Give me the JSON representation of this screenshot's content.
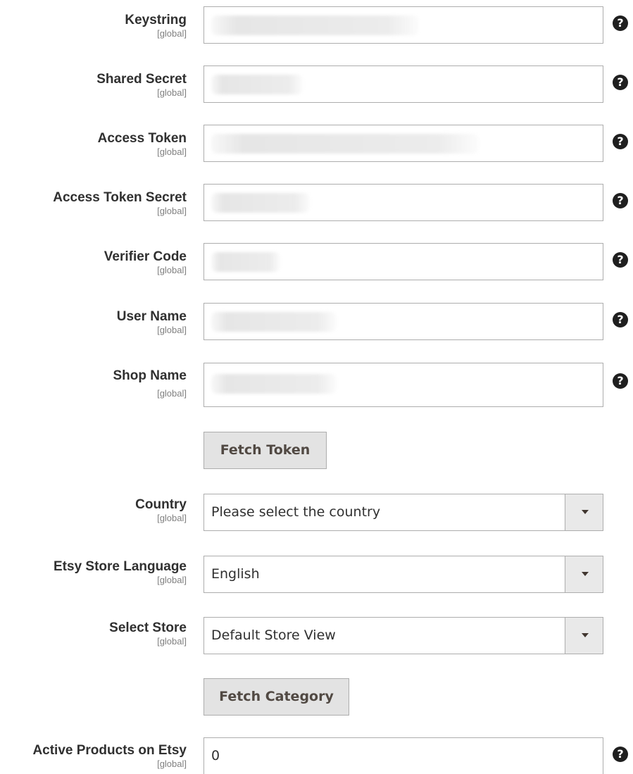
{
  "scope_label": "[global]",
  "fields": {
    "keystring": {
      "label": "Keystring",
      "value": ""
    },
    "shared_secret": {
      "label": "Shared Secret",
      "value": ""
    },
    "access_token": {
      "label": "Access Token",
      "value": ""
    },
    "access_token_secret": {
      "label": "Access Token Secret",
      "value": ""
    },
    "verifier_code": {
      "label": "Verifier Code",
      "value": ""
    },
    "user_name": {
      "label": "User Name",
      "value": ""
    },
    "shop_name": {
      "label": "Shop Name",
      "value": ""
    },
    "country": {
      "label": "Country",
      "selected": "Please select the country"
    },
    "store_language": {
      "label": "Etsy Store Language",
      "selected": "English"
    },
    "select_store": {
      "label": "Select Store",
      "selected": "Default Store View"
    },
    "active_products": {
      "label": "Active Products on Etsy",
      "value": "0"
    }
  },
  "buttons": {
    "fetch_token": "Fetch Token",
    "fetch_category": "Fetch Category"
  },
  "help_icon_glyph": "?",
  "icons": {
    "help": "question-circle-icon",
    "dropdown": "caret-down-icon"
  },
  "colors": {
    "border": "#adadad",
    "button_bg": "#e3e3e3",
    "caret_bg": "#e9e9e9",
    "label": "#303030",
    "scope": "#808080",
    "help_bg": "#1f1f1f"
  }
}
